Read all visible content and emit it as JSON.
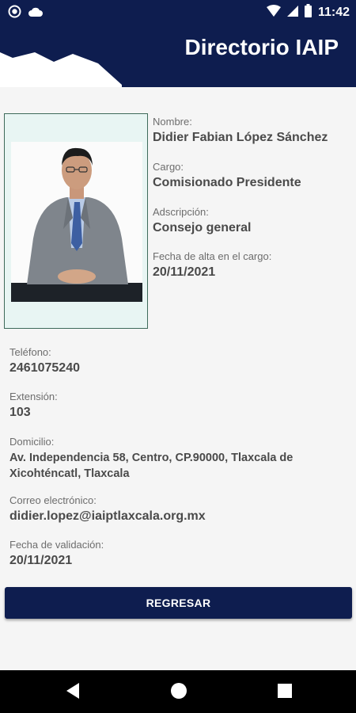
{
  "status_bar": {
    "time": "11:42",
    "icons_left": [
      "circle-icon",
      "cloud-icon"
    ],
    "icons_right": [
      "wifi-icon",
      "signal-icon",
      "battery-icon"
    ]
  },
  "header": {
    "title": "Directorio IAIP"
  },
  "profile": {
    "nombre_label": "Nombre:",
    "nombre": "Didier Fabian López Sánchez",
    "cargo_label": "Cargo:",
    "cargo": "Comisionado Presidente",
    "adscripcion_label": "Adscripción:",
    "adscripcion": "Consejo general",
    "fecha_alta_label": "Fecha de alta en el cargo:",
    "fecha_alta": "20/11/2021",
    "telefono_label": "Teléfono:",
    "telefono": "2461075240",
    "extension_label": "Extensión:",
    "extension": "103",
    "domicilio_label": "Domicilio:",
    "domicilio_line1": "Av. Independencia 58, Centro, CP.90000, Tlaxcala de",
    "domicilio_line2": "Xicohténcatl, Tlaxcala",
    "correo_label": "Correo electrónico:",
    "correo": "didier.lopez@iaiptlaxcala.org.mx",
    "fecha_validacion_label": "Fecha de validación:",
    "fecha_validacion": "20/11/2021"
  },
  "actions": {
    "back_label": "REGRESAR"
  },
  "colors": {
    "brand": "#0e1d4f",
    "background": "#f5f5f5"
  }
}
